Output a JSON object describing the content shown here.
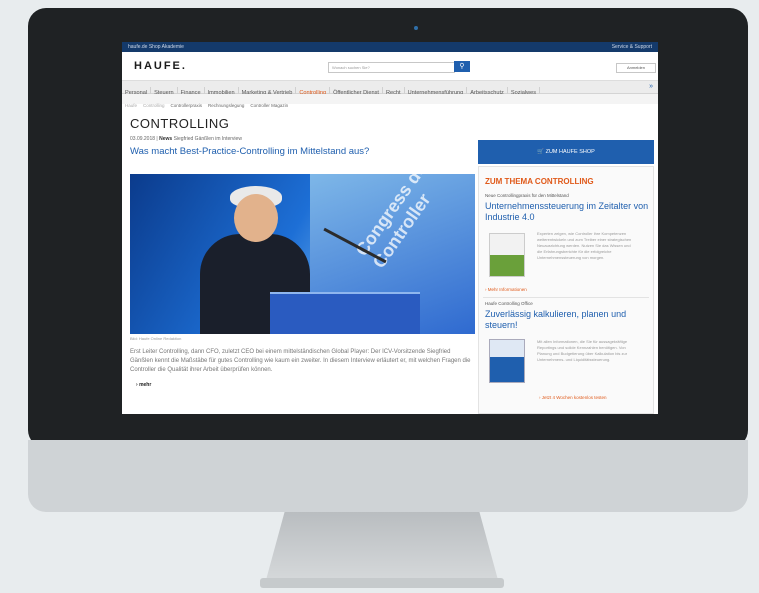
{
  "topbar": {
    "left": "haufe.de  Shop  Akademie",
    "right": "Service & Support"
  },
  "header": {
    "logo": "HAUFE.",
    "search_placeholder": "Wonach suchen Sie?",
    "search_icon": "search-icon",
    "account": "Anmelden"
  },
  "nav": {
    "items": [
      "Personal",
      "Steuern",
      "Finance",
      "Immobilien",
      "Marketing & Vertrieb",
      "Controlling",
      "Öffentlicher Dienst",
      "Recht",
      "Unternehmensführung",
      "Arbeitsschutz",
      "Sozialwes"
    ],
    "active": "Controlling",
    "more_icon": "chevron-right-icon"
  },
  "subnav": {
    "items": [
      "Haufe",
      "Controlling",
      "Controllerpraxis",
      "Rechnungslegung",
      "Controller Magazin"
    ]
  },
  "main": {
    "title": "CONTROLLING",
    "meta_date": "03.09.2018 |",
    "meta_type": "News",
    "meta_rest": "Siegfried Gänßlen im Interview",
    "headline": "Was macht Best-Practice-Controlling im Mittelstand aus?",
    "photo_text": "Congress der Controller",
    "caption": "Bild: Haufe Online Redaktion",
    "body": "Erst Leiter Controlling, dann CFO, zuletzt CEO bei einem mittelständischen Global Player: Der ICV-Vorsitzende Siegfried Gänßlen kennt die Maßstäbe für gutes Controlling wie kaum ein zweiter. In diesem Interview erläutert er, mit welchen Fragen die Controller die Qualität ihrer Arbeit überprüfen können.",
    "more": "mehr"
  },
  "sidebar": {
    "shop_button": "ZUM HAUFE SHOP",
    "section_title": "ZUM THEMA CONTROLLING",
    "item1": {
      "label": "Neue Controllingpraxis für den Mittelstand",
      "title": "Unternehmenssteuerung im Zeitalter von Industrie 4.0",
      "text": "Experten zeigen, wie Controller ihre Kompetenzen weiterentwickeln und zum Treiber einer strategischen Neuausrichtung werden. Nutzen Sie das Wissen und die Erfahrungsberichte für die erfolgreiche Unternehmenssteuerung von morgen.",
      "link": "Mehr Informationen"
    },
    "item2": {
      "label": "Haufe Controlling Office",
      "title": "Zuverlässig kalkulieren, planen und steuern!",
      "text": "Mit allen Informationen, die Sie für aussagekräftige Reportings und solide Kennzahlen benötigen. Von Planung und Budgetierung über Kalkulation bis zur Unternehmens- und Liquiditätssteuerung.",
      "link": "Jetzt 4 Wochen kostenlos testen"
    }
  }
}
